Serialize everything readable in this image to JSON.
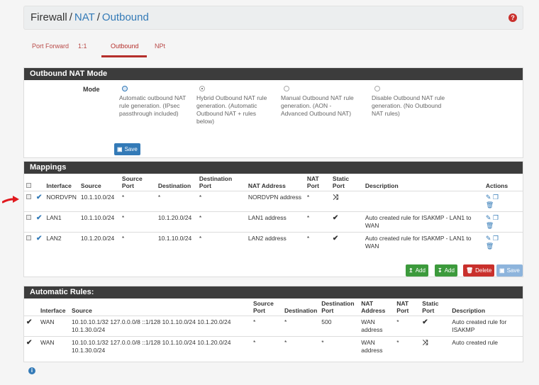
{
  "breadcrumb": {
    "root": "Firewall",
    "sep": "/",
    "items": [
      "NAT",
      "Outbound"
    ]
  },
  "tabs": [
    "Port Forward",
    "1:1",
    "Outbound",
    "NPt"
  ],
  "mode_panel": {
    "title": "Outbound NAT Mode",
    "label": "Mode",
    "options": [
      "Automatic outbound NAT rule generation. (IPsec passthrough included)",
      "Hybrid Outbound NAT rule generation. (Automatic Outbound NAT + rules below)",
      "Manual Outbound NAT rule generation. (AON - Advanced Outbound NAT)",
      "Disable Outbound NAT rule generation. (No Outbound NAT rules)"
    ],
    "save_label": "Save"
  },
  "mappings": {
    "title": "Mappings",
    "headers": [
      "Interface",
      "Source",
      "Source Port",
      "Destination",
      "Destination Port",
      "NAT Address",
      "NAT Port",
      "Static Port",
      "Description",
      "Actions"
    ],
    "rows": [
      {
        "iface": "NORDVPN",
        "source": "10.1.10.0/24",
        "sport": "*",
        "dest": "*",
        "dport": "*",
        "nat": "NORDVPN address",
        "natport": "*",
        "desc": ""
      },
      {
        "iface": "LAN1",
        "source": "10.1.10.0/24",
        "sport": "*",
        "dest": "10.1.20.0/24",
        "dport": "*",
        "nat": "LAN1 address",
        "natport": "*",
        "desc": "Auto created rule for ISAKMP - LAN1 to WAN"
      },
      {
        "iface": "LAN2",
        "source": "10.1.20.0/24",
        "sport": "*",
        "dest": "10.1.10.0/24",
        "dport": "*",
        "nat": "LAN2 address",
        "natport": "*",
        "desc": "Auto created rule for ISAKMP - LAN1 to WAN"
      }
    ],
    "buttons": {
      "add_top": "Add",
      "add_bottom": "Add",
      "delete": "Delete",
      "save": "Save"
    }
  },
  "auto_rules": {
    "title": "Automatic Rules:",
    "headers": [
      "Interface",
      "Source",
      "Source Port",
      "Destination",
      "Destination Port",
      "NAT Address",
      "NAT Port",
      "Static Port",
      "Description"
    ],
    "rows": [
      {
        "iface": "WAN",
        "source": "10.10.10.1/32 127.0.0.0/8 ::1/128 10.1.10.0/24 10.1.20.0/24 10.1.30.0/24",
        "sport": "*",
        "dest": "*",
        "dport": "500",
        "nat": "WAN address",
        "natport": "*",
        "desc": "Auto created rule for ISAKMP"
      },
      {
        "iface": "WAN",
        "source": "10.10.10.1/32 127.0.0.0/8 ::1/128 10.1.10.0/24 10.1.20.0/24 10.1.30.0/24",
        "sport": "*",
        "dest": "*",
        "dport": "*",
        "nat": "WAN address",
        "natport": "*",
        "desc": "Auto created rule"
      }
    ]
  },
  "colors": {
    "accent": "#337ab7",
    "danger": "#c9302c",
    "success": "#3c9a3c",
    "header": "#3c3c3c",
    "arrow": "#e0191e"
  }
}
